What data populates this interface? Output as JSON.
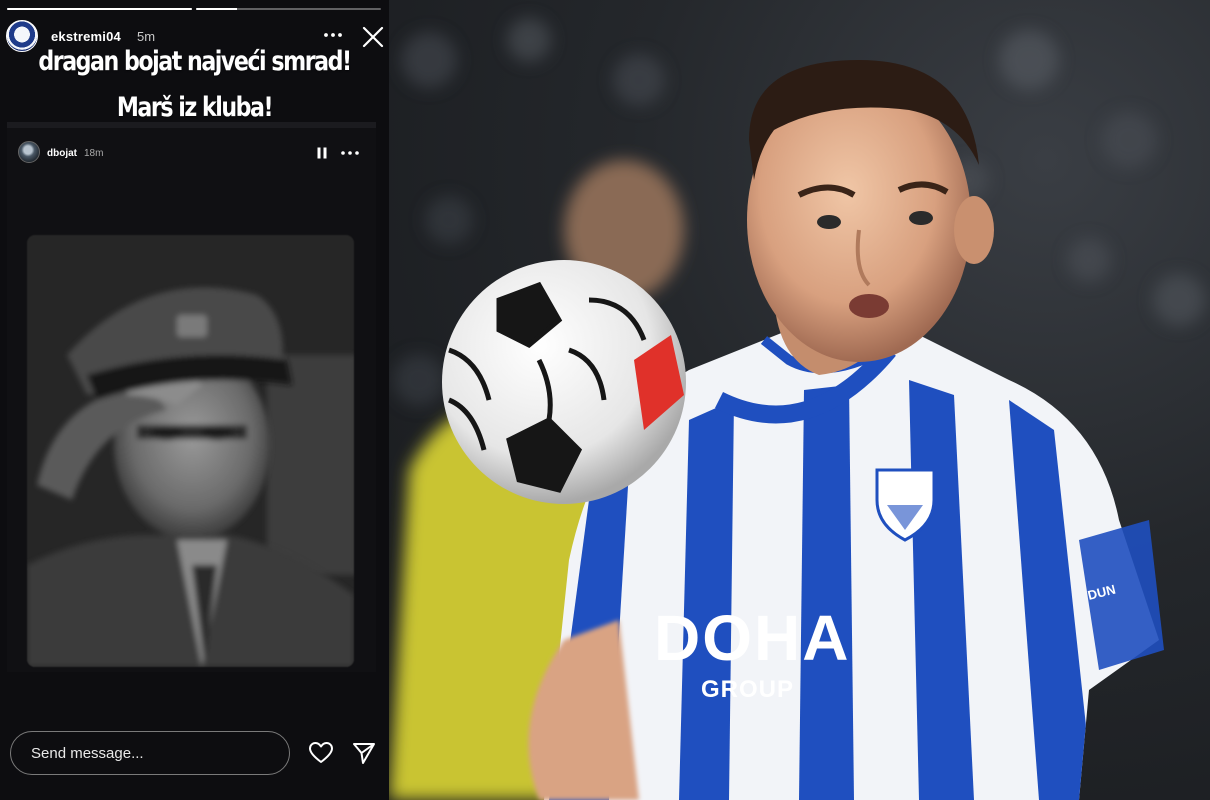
{
  "story": {
    "progress": [
      1.0,
      0.22
    ],
    "header": {
      "username": "ekstremi04",
      "time": "5m",
      "more_icon": "more-horizontal-icon",
      "close_icon": "close-icon"
    },
    "caption": {
      "line1": "dragan bojat najveći smrad!",
      "line2": "Marš iz kluba!"
    },
    "embedded": {
      "username": "dbojat",
      "time": "18m",
      "pause_icon": "pause-icon",
      "more_icon": "more-horizontal-icon"
    },
    "footer": {
      "message_placeholder": "Send message...",
      "like_icon": "heart-icon",
      "send_icon": "send-icon"
    }
  },
  "photo": {
    "sponsor_main": "DOHA",
    "sponsor_sub": "GROUP",
    "colors": {
      "kit_blue": "#1f4fbf",
      "kit_white": "#f2f4f8",
      "ball_accent": "#e0312a"
    }
  }
}
